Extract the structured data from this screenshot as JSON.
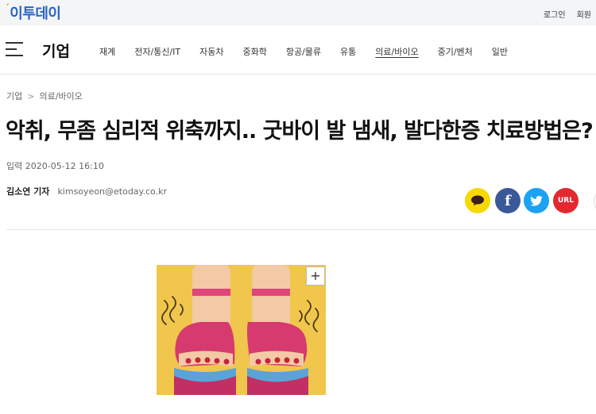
{
  "brand": {
    "logo_text": "이투데이"
  },
  "top_links": [
    "로그인",
    "회원"
  ],
  "section": {
    "title": "기업",
    "subnav": [
      "재계",
      "전자/통신/IT",
      "자동차",
      "중화학",
      "항공/물류",
      "유통",
      "의료/바이오",
      "중기/벤처",
      "일반"
    ],
    "active": "의료/바이오"
  },
  "breadcrumb": {
    "root": "기업",
    "separator": ">",
    "current": "의료/바이오"
  },
  "article": {
    "headline": "악취, 무좀 심리적 위축까지.. 굿바이 발 냄새, 발다한증 치료방법은?",
    "date": "입력 2020-05-12 16:10",
    "author": "김소연 기자",
    "email": "kimsoyeon@etoday.co.kr"
  },
  "share": {
    "url_label": "URL",
    "facebook_label": "f"
  },
  "image": {
    "zoom_label": "+"
  },
  "colors": {
    "brand": "#2a64c8",
    "kakao": "#f7d900",
    "facebook": "#3b5998",
    "twitter": "#1da1f2",
    "url": "#e2292f"
  }
}
